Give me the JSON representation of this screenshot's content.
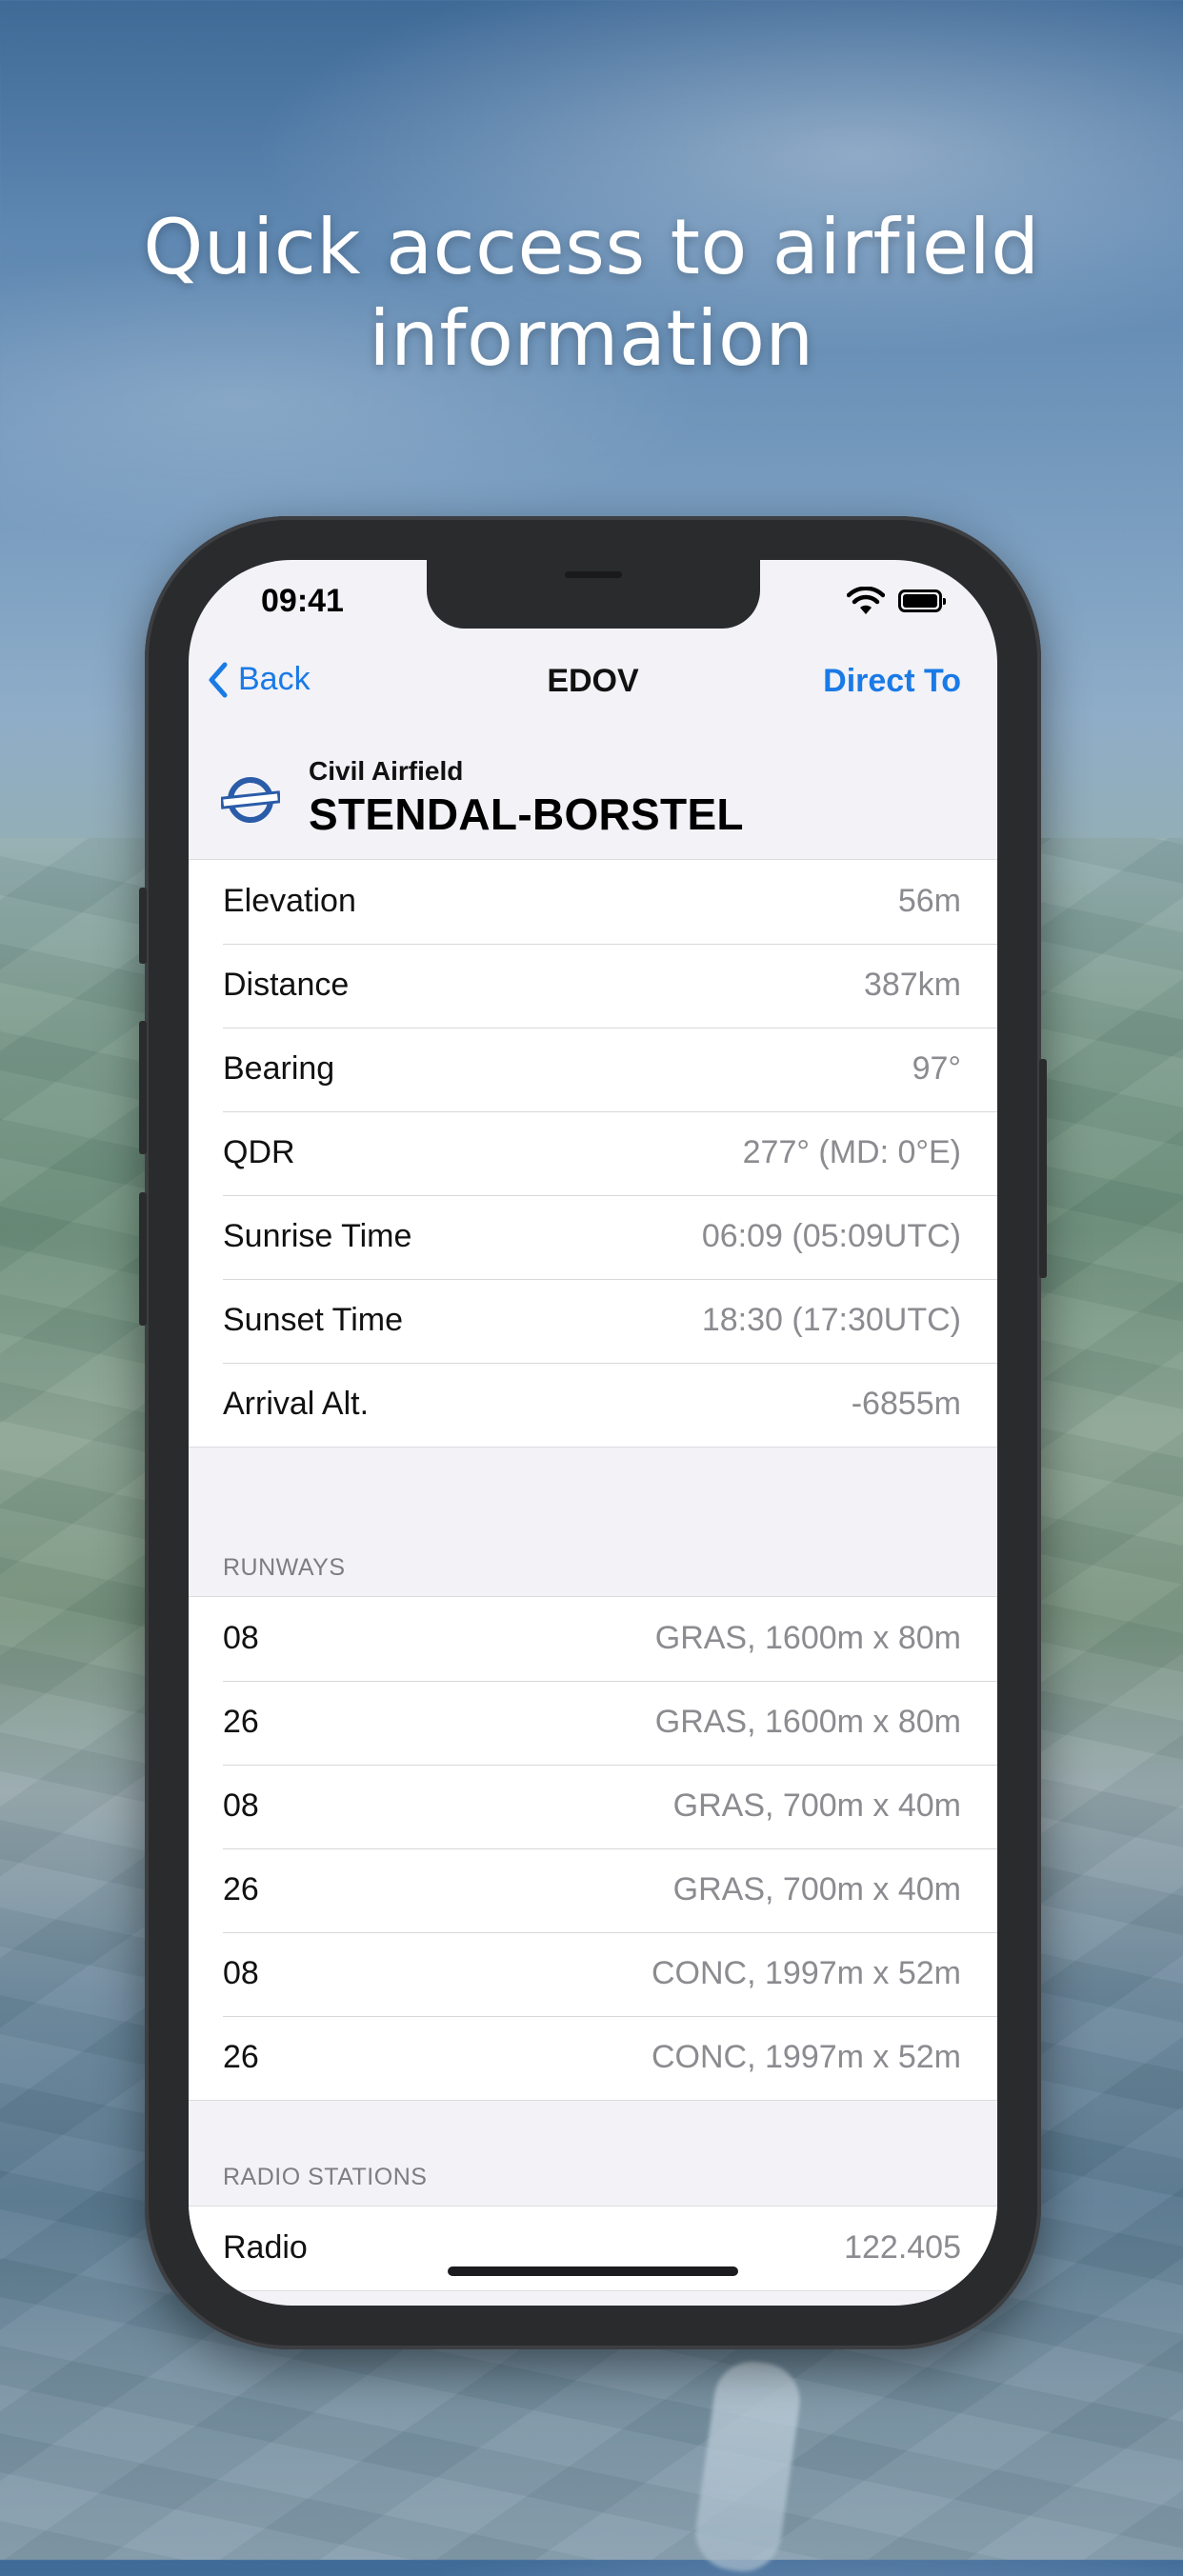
{
  "headline": {
    "line1": "Quick access to airfield",
    "line2": "information"
  },
  "status_bar": {
    "time": "09:41"
  },
  "nav": {
    "back_label": "Back",
    "title": "EDOV",
    "direct_to_label": "Direct To"
  },
  "airfield": {
    "category": "Civil Airfield",
    "name": "STENDAL-BORSTEL"
  },
  "info_rows": [
    {
      "label": "Elevation",
      "value": "56m"
    },
    {
      "label": "Distance",
      "value": "387km"
    },
    {
      "label": "Bearing",
      "value": "97°"
    },
    {
      "label": "QDR",
      "value": "277° (MD: 0°E)"
    },
    {
      "label": "Sunrise Time",
      "value": "06:09 (05:09UTC)"
    },
    {
      "label": "Sunset Time",
      "value": "18:30 (17:30UTC)"
    },
    {
      "label": "Arrival Alt.",
      "value": "-6855m"
    }
  ],
  "runways": {
    "section_title": "RUNWAYS",
    "rows": [
      {
        "label": "08",
        "value": "GRAS, 1600m x 80m"
      },
      {
        "label": "26",
        "value": "GRAS, 1600m x 80m"
      },
      {
        "label": "08",
        "value": "GRAS, 700m x 40m"
      },
      {
        "label": "26",
        "value": "GRAS, 700m x 40m"
      },
      {
        "label": "08",
        "value": "CONC, 1997m x 52m"
      },
      {
        "label": "26",
        "value": "CONC, 1997m x 52m"
      }
    ]
  },
  "radio": {
    "section_title": "RADIO STATIONS",
    "rows": [
      {
        "label": "Radio",
        "value": "122.405"
      }
    ]
  },
  "icons": {
    "back": "chevron-left-icon",
    "wifi": "wifi-icon",
    "battery": "battery-icon",
    "airfield": "civil-airfield-icon"
  },
  "colors": {
    "accent": "#1a7ae6",
    "airfield_symbol": "#2a5ca8"
  }
}
